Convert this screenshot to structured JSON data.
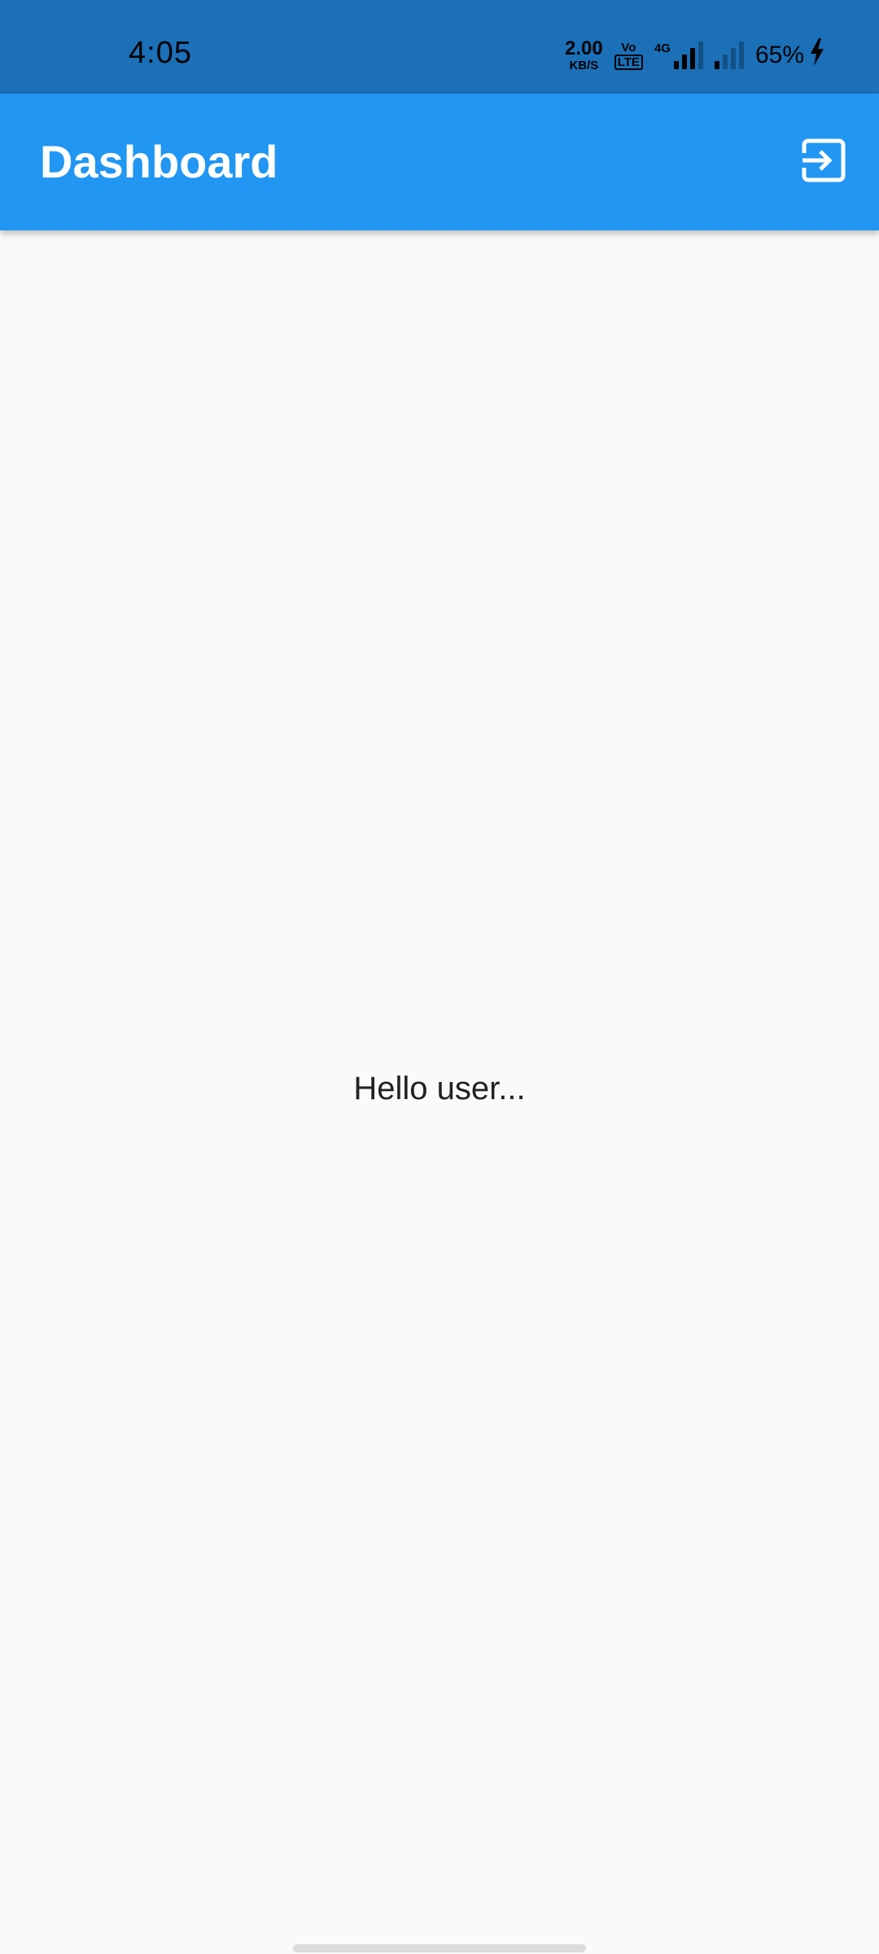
{
  "status_bar": {
    "time": "4:05",
    "net_speed_value": "2.00",
    "net_speed_unit": "KB/S",
    "volte_top": "Vo",
    "volte_bottom": "LTE",
    "network_type": "4G",
    "battery": "65%",
    "icons": [
      "volte-icon",
      "signal-strength-icon",
      "signal-strength-icon",
      "charging-bolt-icon"
    ]
  },
  "app_bar": {
    "title": "Dashboard",
    "action_icon": "logout-icon",
    "background_color": "#2196f3"
  },
  "main": {
    "greeting": "Hello user..."
  }
}
